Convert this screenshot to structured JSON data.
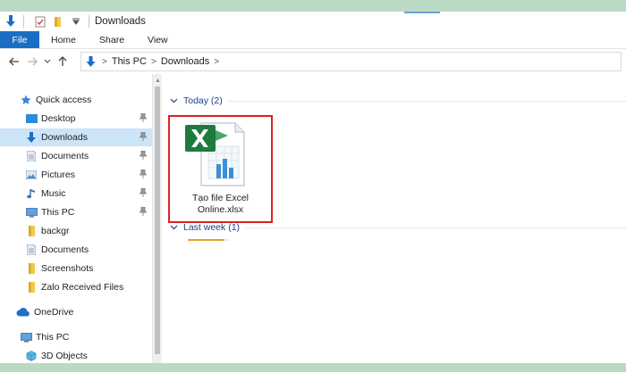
{
  "window": {
    "title": "Downloads"
  },
  "ribbon": {
    "tabs": [
      "File",
      "Home",
      "Share",
      "View"
    ]
  },
  "address": {
    "crumbs": [
      "This PC",
      "Downloads"
    ]
  },
  "nav": {
    "quick_access": "Quick access",
    "pinned": [
      "Desktop",
      "Downloads",
      "Documents",
      "Pictures",
      "Music",
      "This PC"
    ],
    "recent": [
      "backgr",
      "Documents",
      "Screenshots",
      "Zalo Received Files"
    ],
    "onedrive": "OneDrive",
    "this_pc": "This PC",
    "objects": "3D Objects",
    "selected": "Downloads"
  },
  "content": {
    "groups": [
      {
        "label": "Today (2)"
      },
      {
        "label": "Last week (1)"
      }
    ],
    "file": {
      "name_line1": "Tạo file Excel",
      "name_line2": "Online.xlsx",
      "type_icon": "excel-file-icon"
    },
    "load_progress": 0.85
  },
  "colors": {
    "accent": "#1a6fc4",
    "selection": "#cce4f7",
    "highlight_border": "#e02020",
    "excel_green": "#1f7a3e"
  }
}
